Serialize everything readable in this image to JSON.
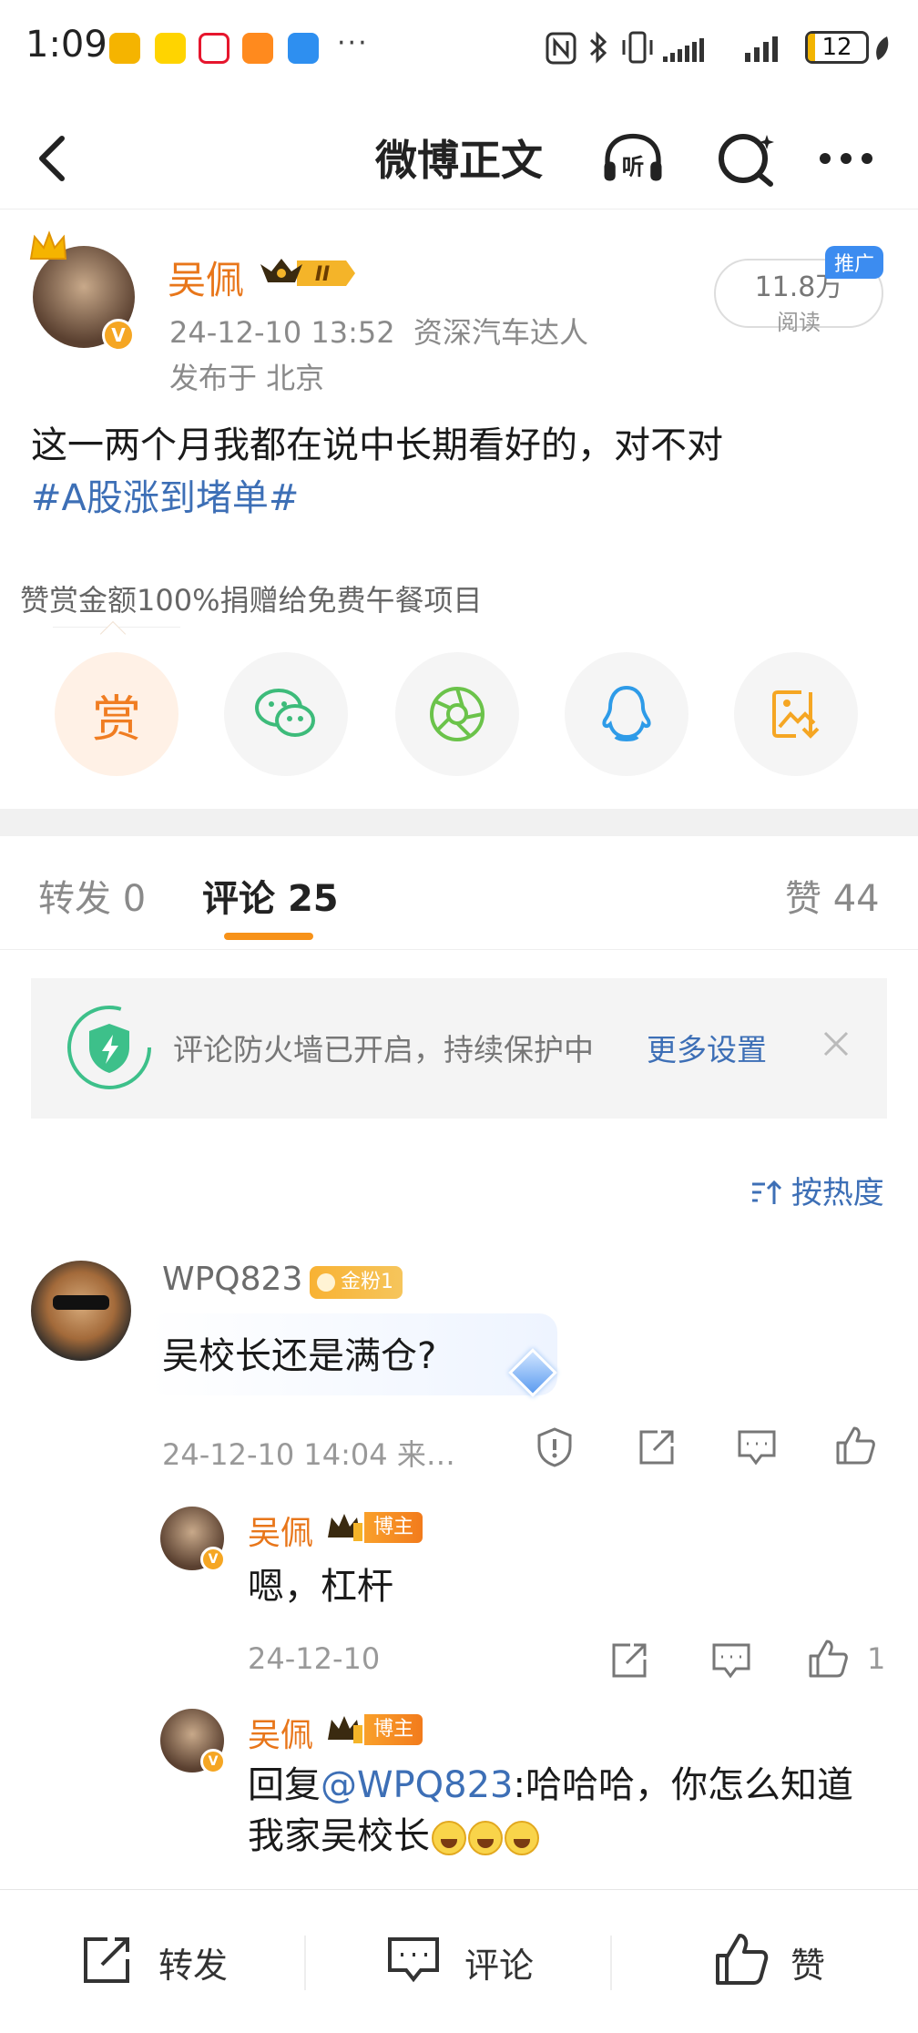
{
  "status_bar": {
    "time": "1:09",
    "more": "···",
    "battery": "12",
    "app_colors": [
      "#f5b400",
      "#ffd400",
      "#ffffff",
      "#ff8a1e",
      "#2e8ff0"
    ]
  },
  "nav": {
    "title": "微博正文",
    "listen_label": "听"
  },
  "post": {
    "author": "吴佩",
    "level_badge": "II",
    "time": "24-12-10 13:52",
    "source": "资深汽车达人",
    "location": "发布于 北京",
    "reads_count": "11.8万",
    "reads_label": "阅读",
    "promo_tag": "推广",
    "text": "这一两个月我都在说中长期看好的，对不对",
    "hashtag": "#A股涨到堵单#"
  },
  "reward": {
    "tip": "赞赏金额100%捐赠给免费午餐项目",
    "button_char": "赏"
  },
  "tabs": {
    "repost_label": "转发",
    "repost_count": "0",
    "comment_label": "评论",
    "comment_count": "25",
    "like_label": "赞",
    "like_count": "44"
  },
  "firewall": {
    "text": "评论防火墙已开启，持续保护中",
    "link": "更多设置"
  },
  "sort": {
    "label": "按热度"
  },
  "comments": [
    {
      "user": "WPQ823",
      "fan_badge": "金粉1",
      "text": "吴校长还是满仓?",
      "meta": "24-12-10 14:04 来…",
      "replies": [
        {
          "user": "吴佩",
          "badge": "博主",
          "text": "嗯，杠杆",
          "meta": "24-12-10",
          "likes": "1"
        },
        {
          "user": "吴佩",
          "badge": "博主",
          "reply_prefix": "回复",
          "mention": "@WPQ823",
          "text_line1": ":哈哈哈，你怎么知道",
          "text_line2": "我家吴校长"
        }
      ]
    }
  ],
  "bottom_bar": {
    "repost": "转发",
    "comment": "评论",
    "like": "赞"
  },
  "colors": {
    "accent_orange": "#f79219",
    "link_blue": "#3d6fb6",
    "wechat_green": "#3dbb7a",
    "moments_green": "#6bc34a",
    "qq_blue": "#2e9be8",
    "save_orange": "#f5a623"
  }
}
